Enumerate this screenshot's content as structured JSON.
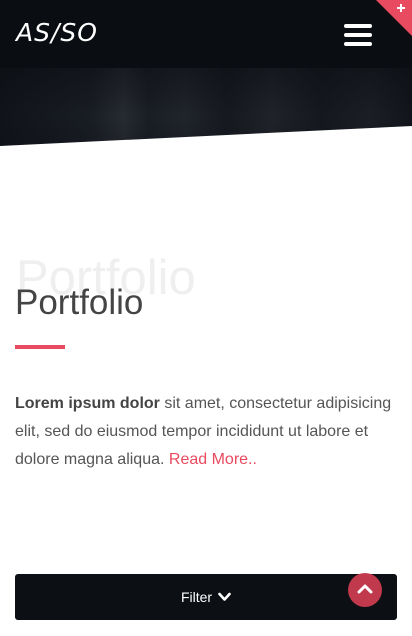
{
  "header": {
    "logo_text": "AS/SO",
    "menu_icon": "hamburger-menu-icon",
    "corner_icon": "plus-icon"
  },
  "section": {
    "background_title": "Portfolio",
    "title": "Portfolio",
    "intro_bold": "Lorem ipsum dolor",
    "intro_text": " sit amet, consectetur adipisicing elit, sed do eiusmod tempor incididunt ut labore et dolore magna aliqua. ",
    "read_more": "Read More.."
  },
  "filter": {
    "label": "Filter",
    "icon": "chevron-down-icon"
  },
  "back_to_top": {
    "icon": "chevron-up-icon"
  },
  "colors": {
    "accent": "#e84a5f",
    "header_bg": "#0a0d11",
    "back_to_top": "#c0394c"
  }
}
